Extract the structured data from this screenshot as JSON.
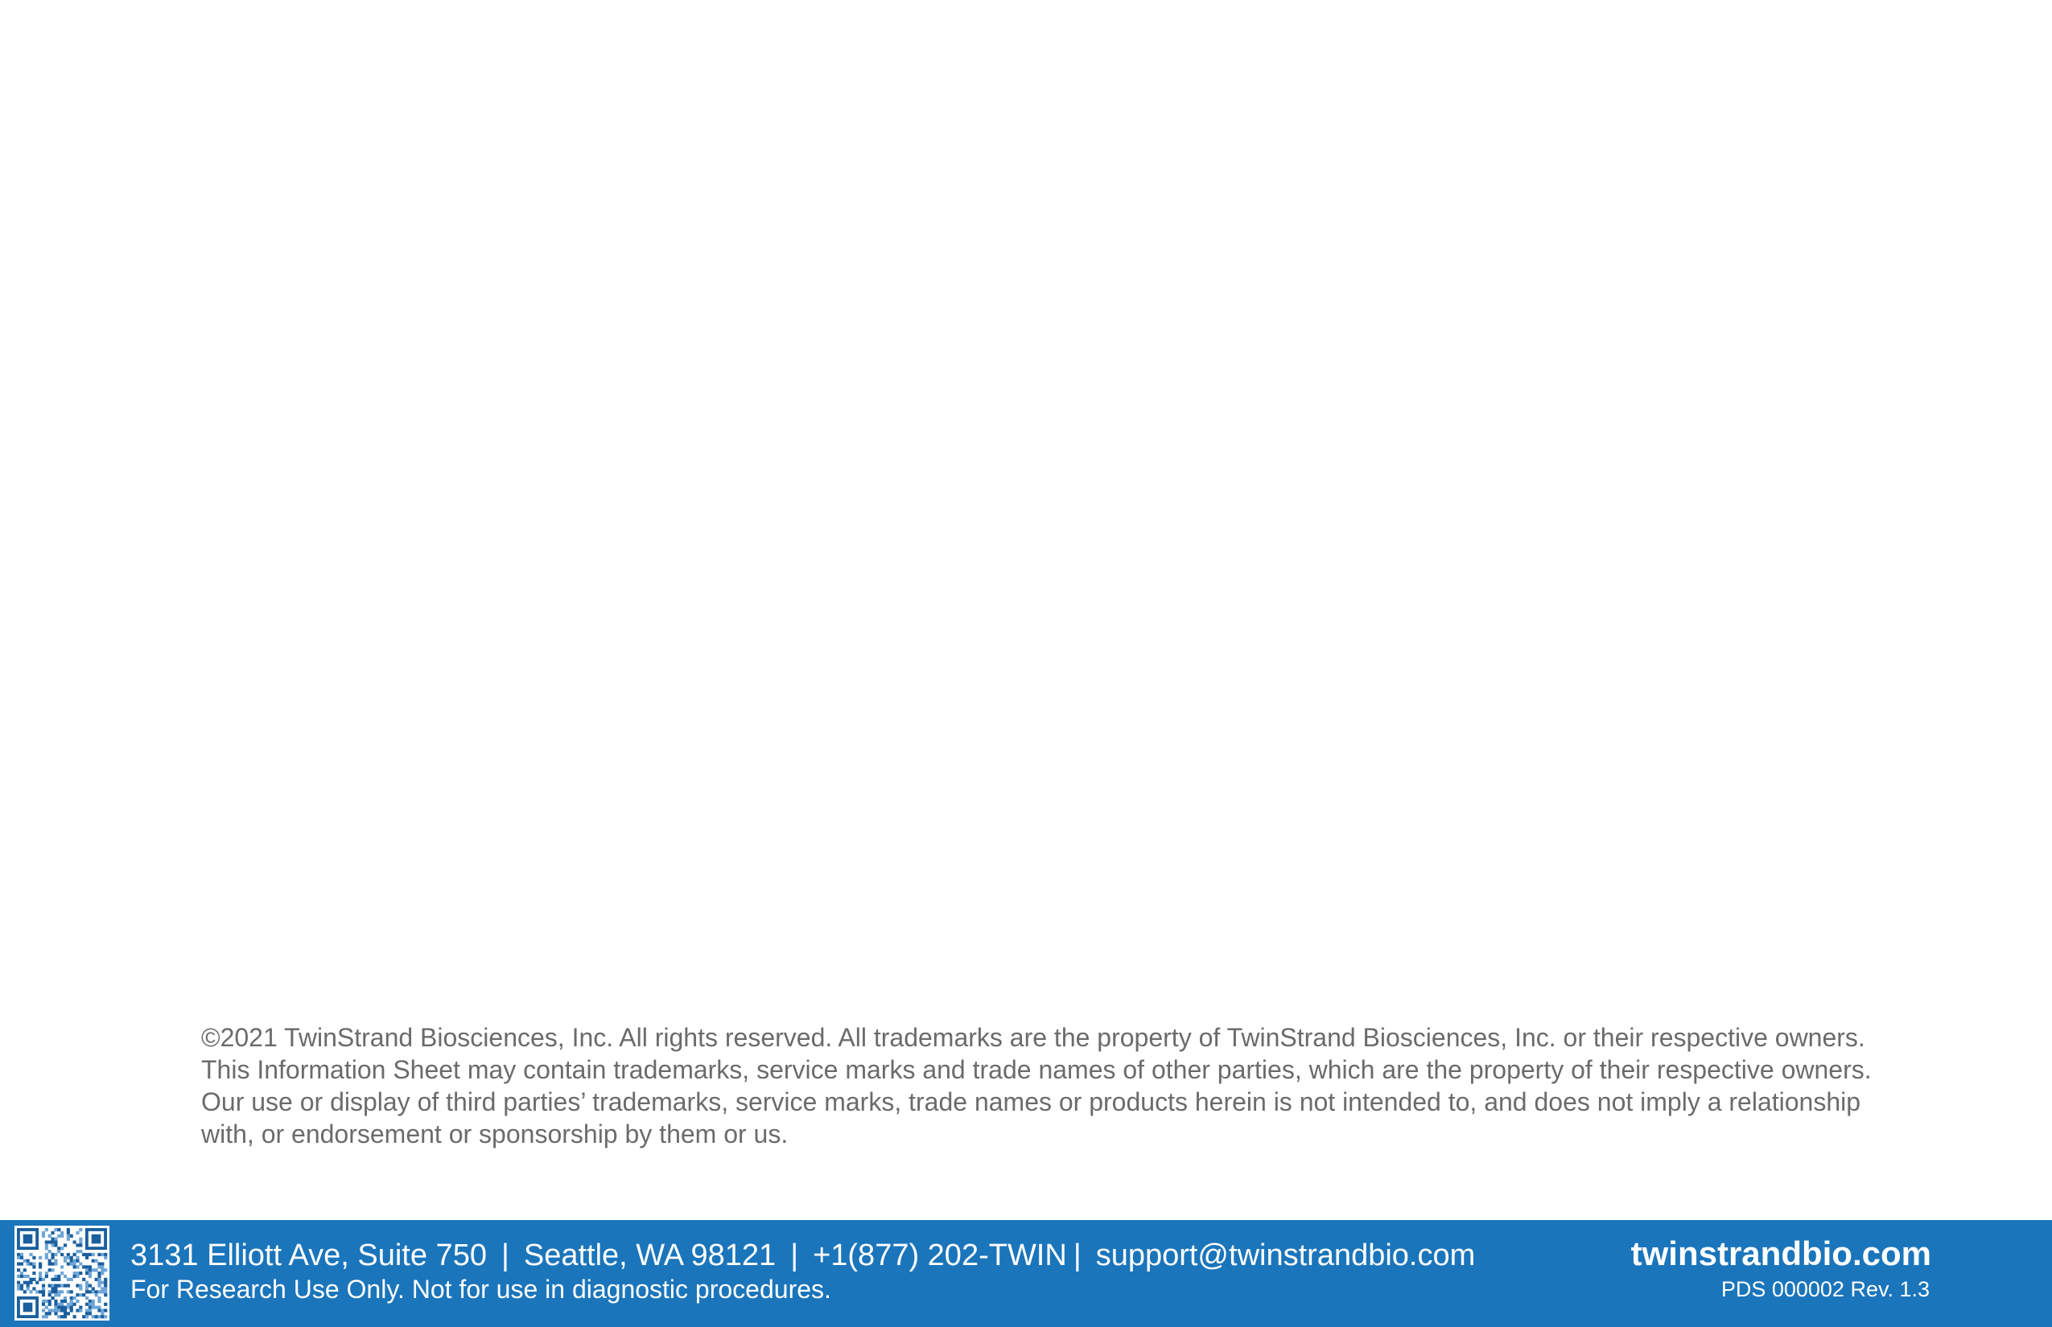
{
  "legal": {
    "line1": "©2021 TwinStrand Biosciences, Inc.  All rights reserved.  All trademarks are the property of TwinStrand Biosciences, Inc. or their respective owners.",
    "line2": "This Information Sheet may contain trademarks, service marks and trade names of other parties, which are the property of their respective owners.",
    "line3": "Our use or display of third parties’ trademarks, service marks, trade names or products herein is not intended to, and does not imply a relationship",
    "line4": "with, or endorsement or sponsorship by them or us."
  },
  "footer": {
    "address": "3131 Elliott Ave, Suite 750",
    "separator": "|",
    "city": "Seattle, WA 98121",
    "phone": "+1(877) 202-TWIN",
    "email": "support@twinstrandbio.com",
    "disclaimer": "For Research Use Only. Not for use in diagnostic procedures.",
    "website": "twinstrandbio.com",
    "doc_id": "PDS 000002 Rev. 1.3",
    "qr_icon": "qr-code-icon"
  },
  "colors": {
    "footer_bg": "#1b75bb",
    "legal_text": "#6b6b6b",
    "footer_text": "#ffffff"
  }
}
